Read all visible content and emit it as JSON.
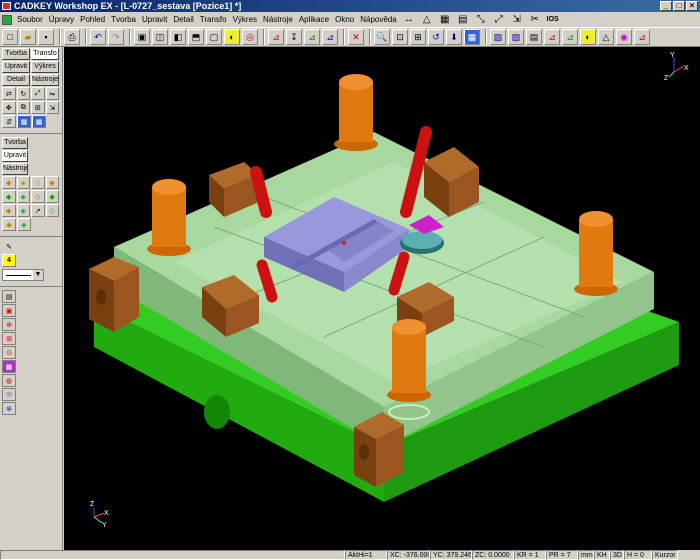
{
  "window": {
    "title": "CADKEY Workshop EX - [L-0727_sestava [Pozice1] *]"
  },
  "menu": [
    "Soubor",
    "Úpravy",
    "Pohled",
    "Tvorba",
    "Upravit",
    "Detail",
    "Transfo",
    "Výkres",
    "Nástroje",
    "Aplikace",
    "Okno",
    "Nápověda"
  ],
  "menu_tools": {
    "ios": "IOS"
  },
  "sidebar": {
    "tabs_row1": [
      "Tvorba",
      "Transfo"
    ],
    "tabs_row2": [
      "Upravit",
      "Výkres"
    ],
    "tabs_row3": [
      "Detail",
      "Nástroje"
    ],
    "tabs2": [
      "Tvorba",
      "Upravit",
      "Nástroje"
    ],
    "layer_num": "4"
  },
  "viewport": {
    "background": "#000000",
    "axis_top": {
      "y": "Y",
      "x": "X",
      "z": "Z"
    },
    "axis_bottom": {
      "y": "Y",
      "x": "X",
      "z": "Z"
    }
  },
  "status": {
    "akthi": "AktHi=1",
    "xc": "XC: -376.0002",
    "yc": "YC: 379.2460",
    "zc": "ZC: 0.0000",
    "kr": "KR = 1",
    "pr": "PR = 7",
    "mm": "mm",
    "kh": "KH",
    "mode": "3D",
    "h": "H = 0",
    "kurzor": "Kurzor"
  }
}
